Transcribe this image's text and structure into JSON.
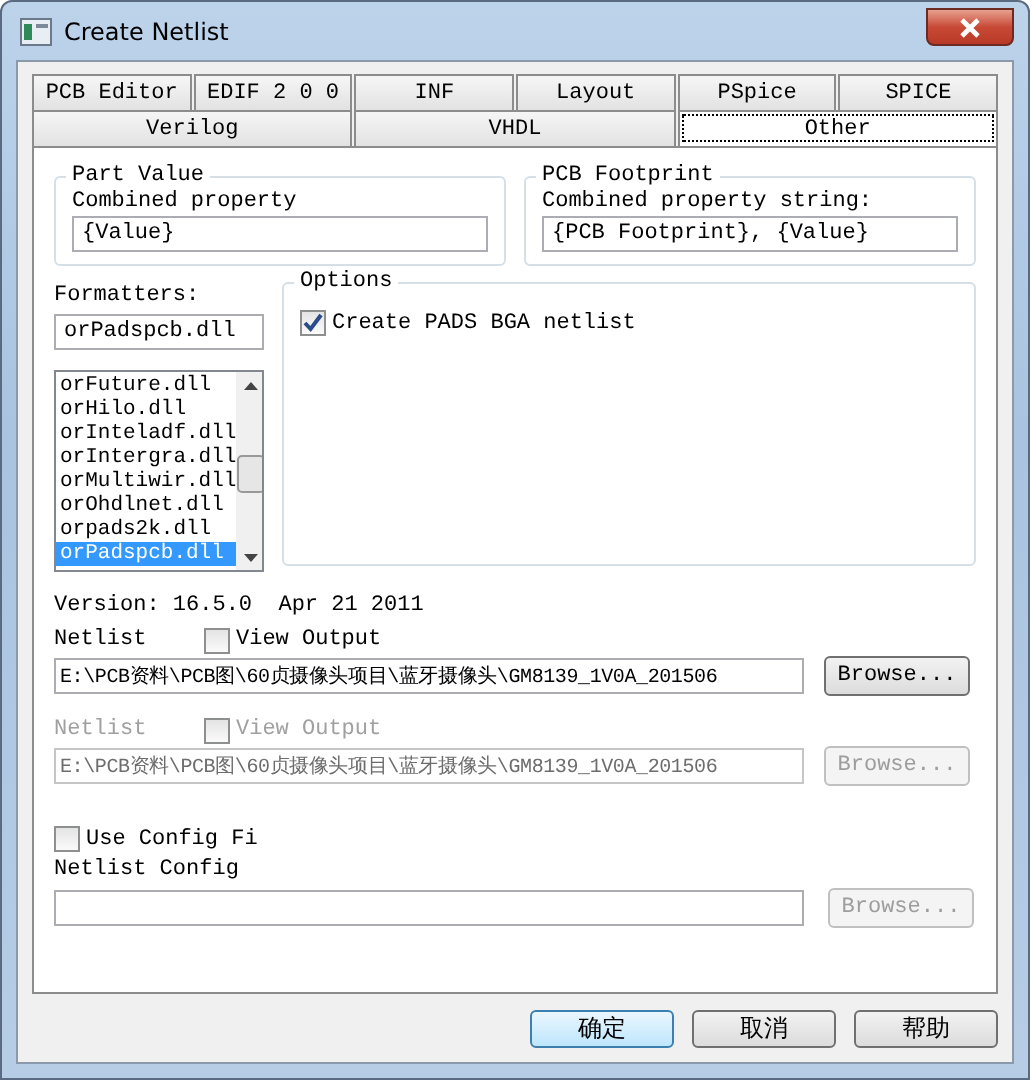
{
  "window": {
    "title": "Create Netlist"
  },
  "tab_rows": [
    [
      {
        "label": "PCB Editor",
        "selected": false
      },
      {
        "label": "EDIF 2 0 0",
        "selected": false
      },
      {
        "label": "INF",
        "selected": false
      },
      {
        "label": "Layout",
        "selected": false
      },
      {
        "label": "PSpice",
        "selected": false
      },
      {
        "label": "SPICE",
        "selected": false
      }
    ],
    [
      {
        "label": "Verilog",
        "selected": false
      },
      {
        "label": "VHDL",
        "selected": false
      },
      {
        "label": "Other",
        "selected": true
      }
    ]
  ],
  "part_value": {
    "title": "Part Value",
    "label": "Combined property",
    "value": "{Value}"
  },
  "pcb_footprint": {
    "title": "PCB Footprint",
    "label": "Combined property string:",
    "value": "{PCB Footprint}, {Value}"
  },
  "formatters": {
    "label": "Formatters:",
    "value": "orPadspcb.dll",
    "items": [
      {
        "label": "orFuture.dll",
        "selected": false
      },
      {
        "label": "orHilo.dll",
        "selected": false
      },
      {
        "label": "orInteladf.dll",
        "selected": false
      },
      {
        "label": "orIntergra.dll",
        "selected": false
      },
      {
        "label": "orMultiwir.dll",
        "selected": false
      },
      {
        "label": "orOhdlnet.dll",
        "selected": false
      },
      {
        "label": "orpads2k.dll",
        "selected": false
      },
      {
        "label": "orPadspcb.dll",
        "selected": true
      }
    ]
  },
  "options": {
    "title": "Options",
    "items": [
      {
        "label": "Create PADS BGA netlist",
        "checked": true
      }
    ]
  },
  "version": "Version: 16.5.0  Apr 21 2011",
  "netlists": [
    {
      "label": "Netlist",
      "disabled": false,
      "view_output": {
        "label": "View Output",
        "checked": false
      },
      "path": "E:\\PCB资料\\PCB图\\60贞摄像头项目\\蓝牙摄像头\\GM8139_1V0A_201506",
      "browse": "Browse..."
    },
    {
      "label": "Netlist",
      "disabled": true,
      "view_output": {
        "label": "View Output",
        "checked": false
      },
      "path": "E:\\PCB资料\\PCB图\\60贞摄像头项目\\蓝牙摄像头\\GM8139_1V0A_201506",
      "browse": "Browse..."
    }
  ],
  "use_config_file": {
    "label": "Use Config Fi",
    "checked": false
  },
  "netlist_config": {
    "label": "Netlist Config",
    "browse": "Browse...",
    "browse_disabled": true
  },
  "buttons": [
    {
      "label": "确定",
      "default": true
    },
    {
      "label": "取消",
      "default": false
    },
    {
      "label": "帮助",
      "default": false
    }
  ]
}
